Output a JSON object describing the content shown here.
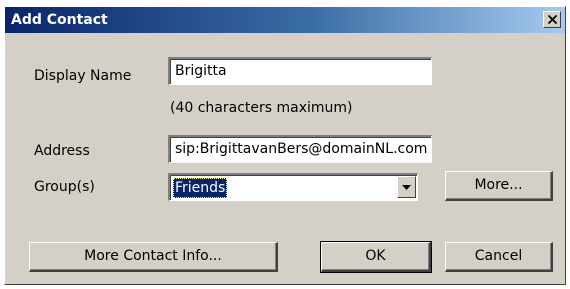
{
  "window": {
    "title": "Add Contact",
    "close_icon": "close-icon"
  },
  "form": {
    "display_name_label": "Display Name",
    "display_name_value": "Brigitta",
    "max_chars_hint": "(40 characters maximum)",
    "address_label": "Address",
    "address_value": "sip:BrigittavanBers@domainNL.com",
    "group_label": "Group(s)",
    "group_value": "Friends",
    "more_button": "More..."
  },
  "buttons": {
    "more_contact_info": "More Contact Info...",
    "ok": "OK",
    "cancel": "Cancel"
  }
}
